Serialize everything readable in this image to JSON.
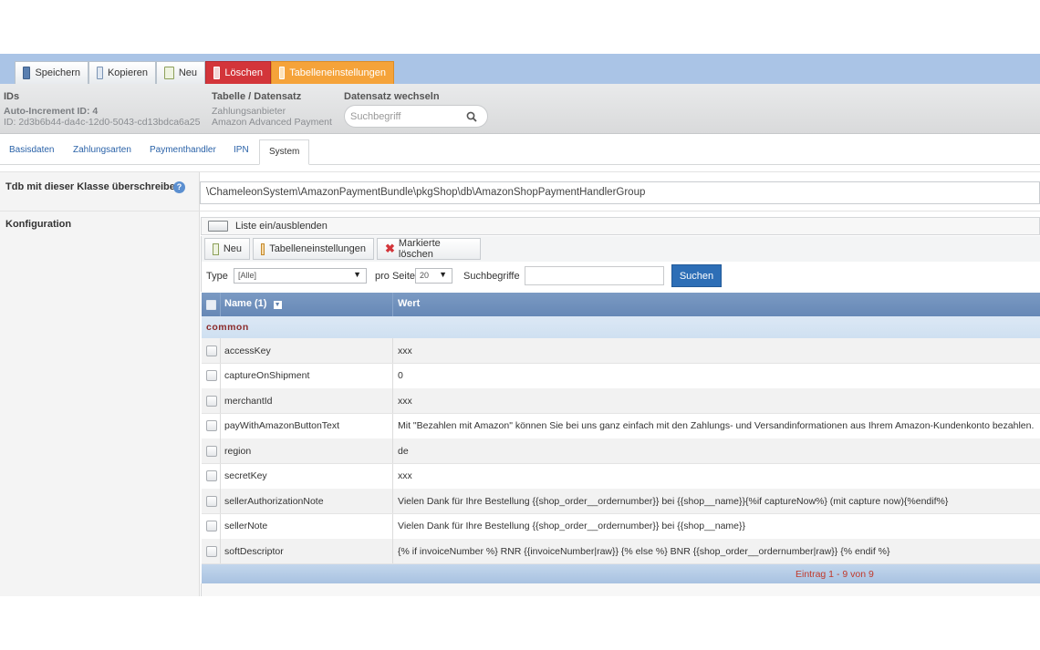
{
  "toolbar": {
    "buttons": [
      {
        "label": "Speichern"
      },
      {
        "label": "Kopieren"
      },
      {
        "label": "Neu"
      },
      {
        "label": "Löschen"
      },
      {
        "label": "Tabelleneinstellungen"
      }
    ]
  },
  "info": {
    "ids_heading": "IDs",
    "auto_increment": "Auto-Increment ID: 4",
    "id": "ID: 2d3b6b44-da4c-12d0-5043-cd13bdca6a25",
    "table_heading": "Tabelle / Datensatz",
    "table_name": "Zahlungsanbieter",
    "record_name": "Amazon Advanced Payment",
    "switch_heading": "Datensatz wechseln",
    "search_placeholder": "Suchbegriff"
  },
  "tabs": [
    "Basisdaten",
    "Zahlungsarten",
    "Paymenthandler",
    "IPN",
    "System"
  ],
  "form": {
    "class_label": "Tdb mit dieser Klasse überschreiben",
    "class_value": "\\ChameleonSystem\\AmazonPaymentBundle\\pkgShop\\db\\AmazonShopPaymentHandlerGroup",
    "config_label": "Konfiguration"
  },
  "list": {
    "toggle_label": "Liste ein/ausblenden",
    "buttons": [
      "Neu",
      "Tabelleneinstellungen",
      "Markierte löschen"
    ],
    "type_label": "Type",
    "type_value": "[Alle]",
    "per_page_label": "pro Seite",
    "per_page_value": "20",
    "search_label": "Suchbegriffe",
    "search_button": "Suchen",
    "columns": [
      "Name (1)",
      "Wert"
    ],
    "group": "common",
    "rows": [
      {
        "name": "accessKey",
        "value": "xxx"
      },
      {
        "name": "captureOnShipment",
        "value": "0"
      },
      {
        "name": "merchantId",
        "value": "xxx"
      },
      {
        "name": "payWithAmazonButtonText",
        "value": "Mit \"Bezahlen mit Amazon\" können Sie bei uns ganz einfach mit den Zahlungs- und Versandinformationen aus Ihrem Amazon-Kundenkonto bezahlen."
      },
      {
        "name": "region",
        "value": "de"
      },
      {
        "name": "secretKey",
        "value": "xxx"
      },
      {
        "name": "sellerAuthorizationNote",
        "value": "Vielen Dank für Ihre Bestellung {{shop_order__ordernumber}} bei {{shop__name}}{%if captureNow%} (mit capture now){%endif%}"
      },
      {
        "name": "sellerNote",
        "value": "Vielen Dank für Ihre Bestellung {{shop_order__ordernumber}} bei {{shop__name}}"
      },
      {
        "name": "softDescriptor",
        "value": "{% if invoiceNumber %} RNR {{invoiceNumber|raw}} {% else %} BNR {{shop_order__ordernumber|raw}} {% endif %}"
      }
    ],
    "footer": "Eintrag 1 - 9 von 9"
  },
  "colors": {
    "toolbar_bg": "#aac4e6",
    "delete_red": "#d3353a",
    "settings_orange": "#f5a33a",
    "table_header": "#6f90bc",
    "link_blue": "#2a62a8",
    "group_text": "#8b2a2a"
  }
}
